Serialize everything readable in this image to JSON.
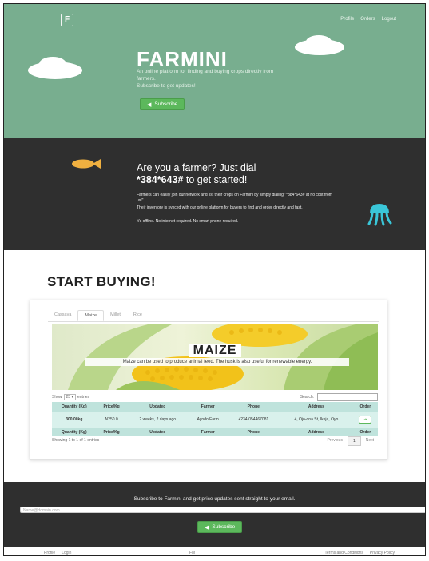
{
  "header": {
    "logo": "F",
    "nav": [
      "Profile",
      "Orders",
      "Logout"
    ],
    "brand": "FARMINI",
    "tagline": [
      "An online platform for finding and buying crops directly from",
      "farmers.",
      "Subscribe to get updates!"
    ],
    "subscribe_label": "Subscribe"
  },
  "dial": {
    "title_line1": "Are you a farmer? Just dial",
    "title_code": "*384*643#",
    "title_line2_rest": " to get started!",
    "p1": "Farmers can easily join our network and list their crops on Farmini by simply dialing \"*384*643# at no cost from us!\"",
    "p2": "Their inventory is synced with our online platform for buyers to find and order directly and fast.",
    "p3": "It's offline. No internet required. No smart phone required."
  },
  "buying": {
    "heading": "START BUYING!",
    "tabs": [
      "Cassava",
      "Maize",
      "Millet",
      "Rice"
    ],
    "active_tab": "Maize",
    "crop_title": "MAIZE",
    "crop_desc": "Maize can be used to produce animal feed. The husk is also useful for renewable energy.",
    "show_label": "Show",
    "entries_value": "25",
    "entries_label": "entries",
    "search_label": "Search:",
    "columns": [
      "Quantity (Kg)",
      "Price/Kg",
      "Updated",
      "Farmer",
      "Phone",
      "Address",
      "Order"
    ],
    "rows": [
      [
        "300.00kg",
        "N250.0",
        "2 weeks, 2 days ago",
        "Ayodo Farm",
        "+234-054467081",
        "4, Ojo-ona St, Ikeja, Oyo",
        "➜"
      ]
    ],
    "info": "Showing 1 to 1 of 1 entries",
    "pager": [
      "Previous",
      "1",
      "Next"
    ]
  },
  "footer": {
    "subscribe_text": "Subscribe to Farmini and get price updates sent straight to your email.",
    "email_placeholder": "Name@domain.com",
    "subscribe_label": "Subscribe",
    "left_links": [
      "Profile",
      "Login"
    ],
    "middle": "FM",
    "right_links": [
      "Terms and Conditions",
      "Privacy Policy"
    ]
  },
  "colors": {
    "hero_bg": "#78ae8f",
    "dark_bg": "#2f2f2f",
    "accent_green": "#5cb85c",
    "table_header": "#bfe3dc"
  }
}
